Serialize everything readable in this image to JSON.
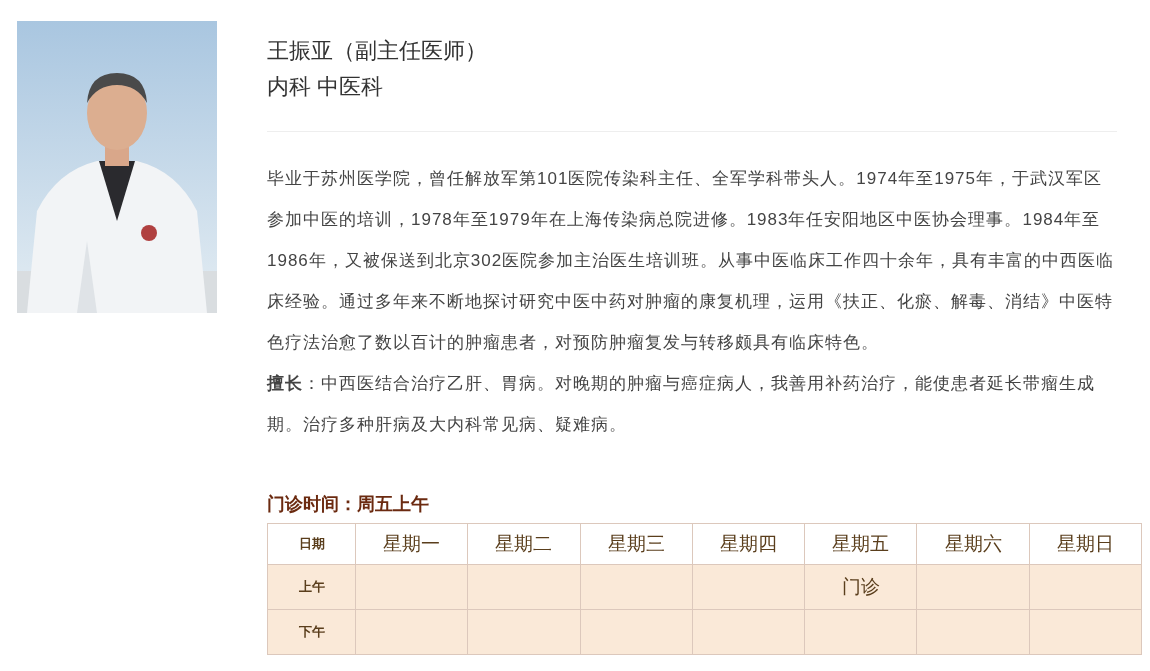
{
  "doctor": {
    "name": "王振亚（副主任医师）",
    "department": "内科 中医科"
  },
  "bio": [
    "毕业于苏州医学院，曾任解放军第101医院传染科主任、全军学科带头人。1974年至1975年，于武汉军区参加中医的培训，1978年至1979年在上海传染病总院进修。1983年任安阳地区中医协会理事。1984年至1986年，又被保送到北京302医院参加主治医生培训班。从事中医临床工作四十余年，具有丰富的中西医临床经验。通过多年来不断地探讨研究中医中药对肿瘤的康复机理，运用《扶正、化瘀、解毒、消结》中医特色疗法治愈了数以百计的肿瘤患者，对预防肿瘤复发与转移颇具有临床特色。",
    "**擅长**：中西医结合治疗乙肝、胃病。对晚期的肿瘤与癌症病人，我善用补药治疗，能使患者延长带瘤生成期。治疗多种肝病及大内科常见病、疑难病。"
  ],
  "schedule": {
    "title": "门诊时间：周五上午",
    "columns": [
      "日期",
      "星期一",
      "星期二",
      "星期三",
      "星期四",
      "星期五",
      "星期六",
      "星期日"
    ],
    "rows": [
      {
        "cells": [
          "上午",
          "",
          "",
          "",
          "",
          "门诊",
          "",
          ""
        ]
      },
      {
        "cells": [
          "下午",
          "",
          "",
          "",
          "",
          "",
          "",
          ""
        ]
      }
    ]
  }
}
